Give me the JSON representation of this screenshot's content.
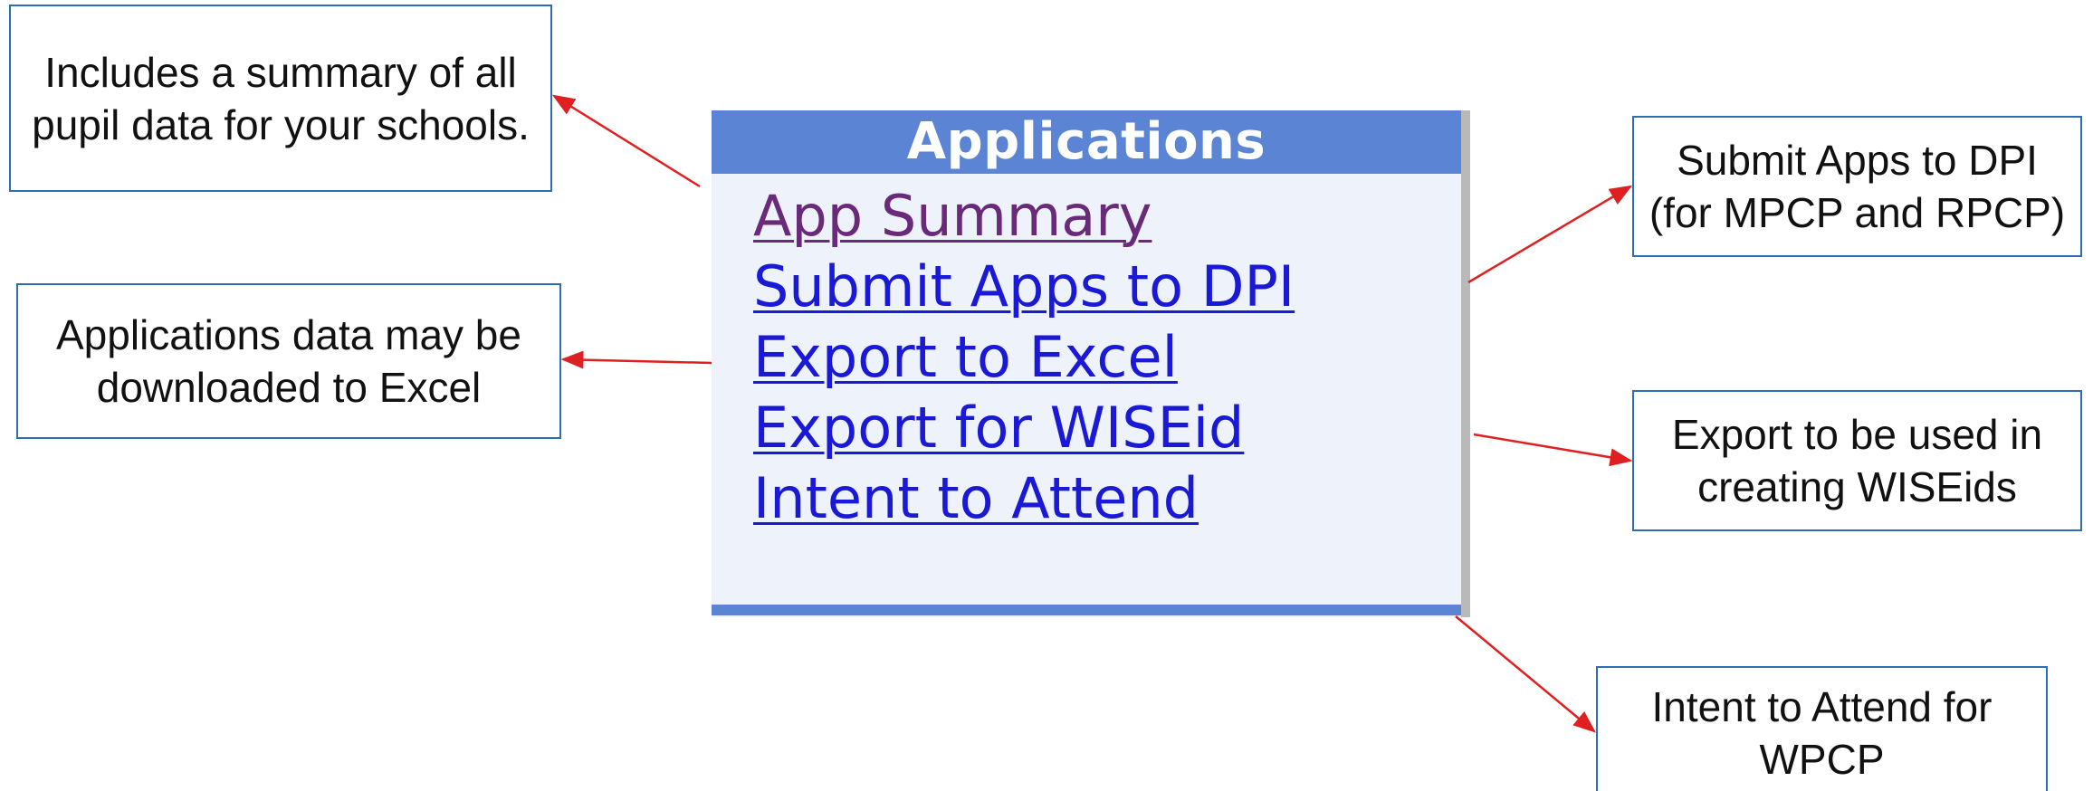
{
  "panel": {
    "title": "Applications",
    "links": [
      {
        "label": "App Summary",
        "visited": true
      },
      {
        "label": "Submit Apps to DPI",
        "visited": false
      },
      {
        "label": "Export to Excel",
        "visited": false
      },
      {
        "label": "Export for WISEid",
        "visited": false
      },
      {
        "label": "Intent to Attend",
        "visited": false
      }
    ]
  },
  "callouts": {
    "summary": "Includes a summary of all pupil data for your schools.",
    "excel": "Applications data may be downloaded to Excel",
    "submit": "Submit Apps to DPI (for MPCP and RPCP)",
    "wiseid": "Export to be used in creating WISEids",
    "intent": "Intent to Attend for WPCP"
  },
  "colors": {
    "header": "#5b84d4",
    "panel_bg": "#eef3fb",
    "link": "#1a1ad6",
    "link_visited": "#6a2a7a",
    "callout_border": "#2e6db4",
    "arrow": "#e02020"
  }
}
